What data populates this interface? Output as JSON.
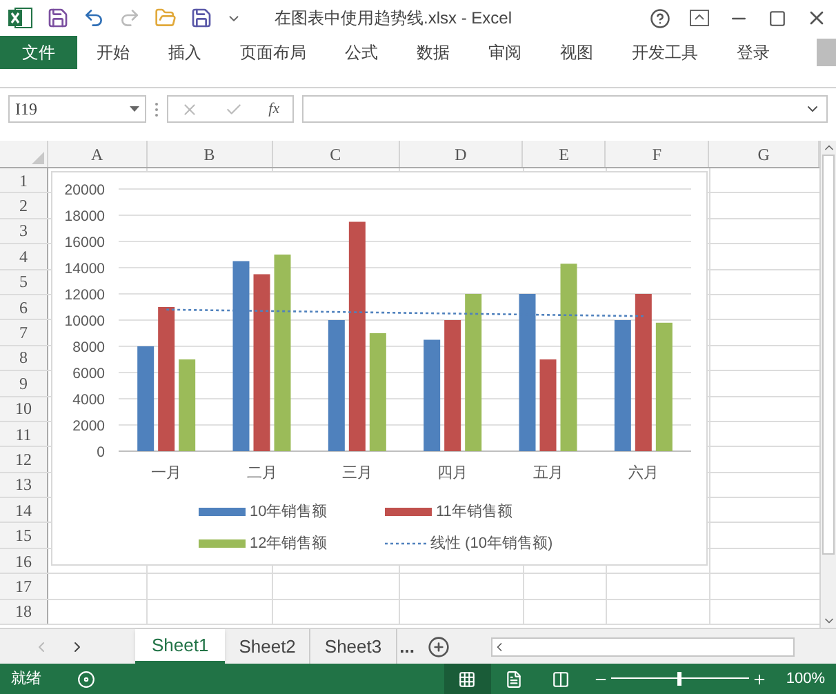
{
  "window": {
    "title": "在图表中使用趋势线.xlsx - Excel"
  },
  "ribbon_tabs": [
    {
      "label": "文件",
      "kind": "file"
    },
    {
      "label": "开始",
      "kind": "tab"
    },
    {
      "label": "插入",
      "kind": "tab"
    },
    {
      "label": "页面布局",
      "kind": "tab"
    },
    {
      "label": "公式",
      "kind": "tab"
    },
    {
      "label": "数据",
      "kind": "tab"
    },
    {
      "label": "审阅",
      "kind": "tab"
    },
    {
      "label": "视图",
      "kind": "tab"
    },
    {
      "label": "开发工具",
      "kind": "tab"
    },
    {
      "label": "登录",
      "kind": "tab"
    }
  ],
  "formula_bar": {
    "name_box": "I19",
    "fx_label": "fx"
  },
  "columns": [
    "A",
    "B",
    "C",
    "D",
    "E",
    "F",
    "G"
  ],
  "rows": [
    "1",
    "2",
    "3",
    "4",
    "5",
    "6",
    "7",
    "8",
    "9",
    "10",
    "11",
    "12",
    "13",
    "14",
    "15",
    "16",
    "17",
    "18"
  ],
  "chart": {
    "chart_data": {
      "type": "bar",
      "categories": [
        "一月",
        "二月",
        "三月",
        "四月",
        "五月",
        "六月"
      ],
      "series": [
        {
          "name": "10年销售额",
          "color": "#4f81bd",
          "values": [
            8000,
            14500,
            10000,
            8500,
            12000,
            10000
          ]
        },
        {
          "name": "11年销售额",
          "color": "#c0504d",
          "values": [
            11000,
            13500,
            17500,
            10000,
            7000,
            12000
          ]
        },
        {
          "name": "12年销售额",
          "color": "#9bbb59",
          "values": [
            7000,
            15000,
            9000,
            12000,
            14300,
            9800
          ]
        },
        {
          "name": "线性 (10年销售额)",
          "color": "#4f81bd",
          "type": "line",
          "line_style": "dotted",
          "values": [
            10800,
            10700,
            10600,
            10500,
            10400,
            10300
          ]
        }
      ],
      "ylim": [
        0,
        20000
      ],
      "yticks": [
        0,
        2000,
        4000,
        6000,
        8000,
        10000,
        12000,
        14000,
        16000,
        18000,
        20000
      ],
      "grid": true,
      "legend": true
    }
  },
  "sheet_tabs": [
    {
      "label": "Sheet1",
      "selected": true
    },
    {
      "label": "Sheet2",
      "selected": false
    },
    {
      "label": "Sheet3",
      "selected": false
    }
  ],
  "more_sheets": "...",
  "status_bar": {
    "status": "就绪",
    "zoom": "100%",
    "zoom_level": {
      "level": 0.5
    },
    "views": [
      {
        "kind": "normal",
        "selected": true
      },
      {
        "kind": "layout",
        "selected": false
      },
      {
        "kind": "pagebreak",
        "selected": false
      }
    ]
  }
}
